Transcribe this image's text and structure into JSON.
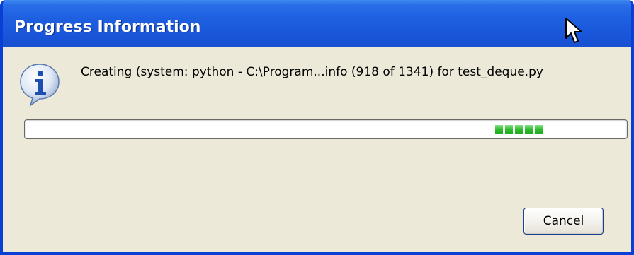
{
  "window": {
    "title": "Progress Information"
  },
  "dialog": {
    "message": "Creating (system: python - C:\\Program...info (918 of 1341) for test_deque.py",
    "icon": "info-icon",
    "progress_blocks": 5
  },
  "buttons": {
    "cancel_label": "Cancel"
  },
  "colors": {
    "titlebar": "#1e5fe0",
    "window_border": "#0a3fd6",
    "dialog_background": "#ece9d8",
    "progress_fill": "#2fbd2f"
  }
}
